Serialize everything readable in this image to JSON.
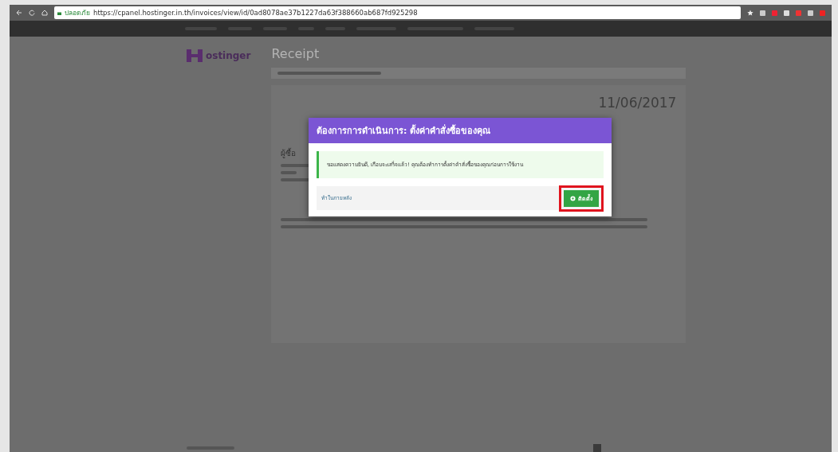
{
  "browser": {
    "security_label": "ปลอดภัย",
    "url": "https://cpanel.hostinger.in.th/invoices/view/id/0ad8078ae37b1227da63f388660ab687fd925298"
  },
  "page": {
    "logo_text": "ostinger",
    "title": "Receipt",
    "invoice_date": "11/06/2017",
    "buyer_heading": "ผู้ซื้อ"
  },
  "modal": {
    "title": "ต้องการการดำเนินการ: ตั้งค่าคำสั่งซื้อของคุณ",
    "message": "ขอแสดงความยินดี, เกือบจะเสร็จแล้ว! คุณต้องทำการตั้งค่าคำสั่งซื้อของคุณก่อนการใช้งาน",
    "later_link": "ทำในภายหลัง",
    "button": "ติดตั้ง",
    "button_highlighted": true
  }
}
